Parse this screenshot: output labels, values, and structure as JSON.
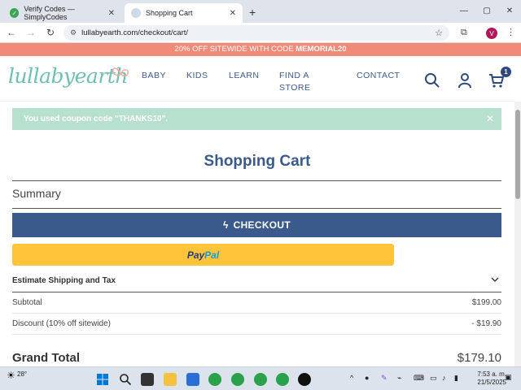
{
  "browser": {
    "tabs": [
      {
        "label": "Verify Codes — SimplyCodes",
        "active": false
      },
      {
        "label": "Shopping Cart",
        "active": true
      }
    ],
    "new_tab": "+",
    "url": "lullabyearth.com/checkout/cart/",
    "profile_initial": "V"
  },
  "promo": {
    "text": "20% OFF SITEWIDE WITH CODE ",
    "code": "MEMORIAL20"
  },
  "header": {
    "logo": "lullabyearth",
    "menu": [
      {
        "label": "BABY"
      },
      {
        "label": "KIDS"
      },
      {
        "label": "LEARN"
      },
      {
        "label": "FIND A STORE"
      },
      {
        "label": "CONTACT"
      }
    ],
    "cart_count": "1"
  },
  "alert": {
    "message": "You used coupon code \"THANKS10\".",
    "close": "✕"
  },
  "cart": {
    "title": "Shopping Cart",
    "summary_label": "Summary",
    "checkout_label": "CHECKOUT",
    "paypal_label_1": "Pay",
    "paypal_label_2": "Pal",
    "estimate_label": "Estimate Shipping and Tax",
    "subtotal_label": "Subtotal",
    "subtotal_value": "$199.00",
    "discount_label": "Discount (10% off sitewide)",
    "discount_value": "- $19.90",
    "grand_total_label": "Grand Total",
    "grand_total_value": "$179.10"
  },
  "taskbar": {
    "weather": "28°",
    "time": "7:53 a. m.",
    "date": "21/5/2025"
  },
  "colors": {
    "brand_blue": "#3b5a8c",
    "brand_teal": "#6fbfb2",
    "promo_bg": "#f08b7a",
    "alert_bg": "#b8e0ce",
    "paypal_bg": "#ffc43a"
  }
}
